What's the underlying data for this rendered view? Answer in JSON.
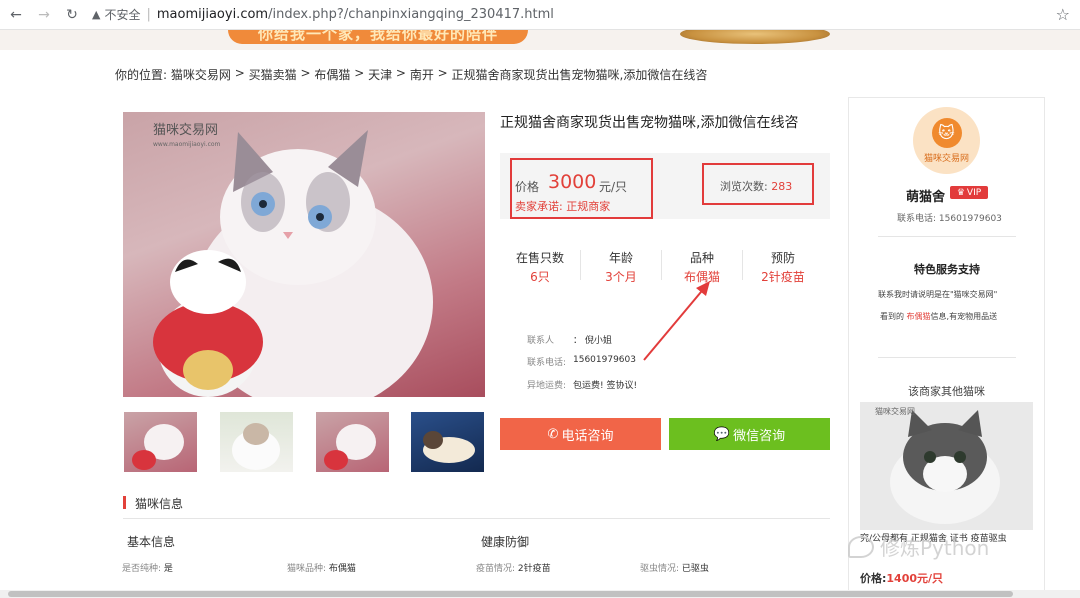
{
  "browser": {
    "back_icon": "arrow-left-icon",
    "forward_icon": "arrow-right-icon",
    "reload_icon": "reload-icon",
    "security_label": "不安全",
    "url_domain": "maomijiaoyi.com",
    "url_path": "/index.php?/chanpinxiangqing_230417.html",
    "bookmark_icon": "star-icon"
  },
  "banner": {
    "slogan": "你给我一个家，我给你最好的陪伴"
  },
  "breadcrumb": {
    "prefix": "你的位置:",
    "items": [
      "猫咪交易网",
      "买猫卖猫",
      "布偶猫",
      "天津",
      "南开",
      "正规猫舍商家现货出售宠物猫咪,添加微信在线咨"
    ],
    "separator": ">"
  },
  "product": {
    "title": "正规猫舍商家现货出售宠物猫咪,添加微信在线咨",
    "photo_watermark_cn": "猫咪交易网",
    "photo_watermark_url": "www.maomijiaoyi.com",
    "price_label": "价格",
    "price_value": "3000",
    "price_unit": "元/只",
    "promise": "卖家承诺: 正规商家",
    "views_label": "浏览次数:",
    "views_value": "283",
    "stats": [
      {
        "label": "在售只数",
        "value": "6只"
      },
      {
        "label": "年龄",
        "value": "3个月"
      },
      {
        "label": "品种",
        "value": "布偶猫"
      },
      {
        "label": "预防",
        "value": "2针疫苗"
      }
    ],
    "contact": {
      "person_label": "联系人",
      "person_value": "： 倪小姐",
      "phone_label": "联系电话:",
      "phone_value": "15601979603",
      "shipping_label": "异地运费:",
      "shipping_value": "包运费! 签协议!"
    },
    "phone_button": "电话咨询",
    "wechat_button": "微信咨询",
    "phone_icon": "phone-icon",
    "wechat_icon": "wechat-icon"
  },
  "info": {
    "section_title": "猫咪信息",
    "basic_title": "基本信息",
    "health_title": "健康防御",
    "items": [
      {
        "label": "是否纯种:",
        "value": "是"
      },
      {
        "label": "猫咪品种:",
        "value": "布偶猫"
      },
      {
        "label": "疫苗情况:",
        "value": "2针疫苗"
      },
      {
        "label": "驱虫情况:",
        "value": "已驱虫"
      }
    ]
  },
  "seller": {
    "logo_text": "猫咪交易网",
    "name": "萌猫舍",
    "vip_label": "VIP",
    "phone_label": "联系电话:",
    "phone": "15601979603",
    "service_title": "特色服务支持",
    "service_note": "联系我时请说明是在\"猫咪交易网\"",
    "service_note2_prefix": "看到的",
    "service_note2_highlight": "布偶猫",
    "service_note2_suffix": "信息,有宠物用品送",
    "other_title": "该商家其他猫咪",
    "other_desc": "究/公母都有 正规猫舍 证书 疫苗驱虫",
    "other_price_label": "价格:",
    "other_price": "1400元/只"
  },
  "watermark_text": "修炼Python",
  "colors": {
    "accent_red": "#e2413a",
    "phone_button": "#f16548",
    "wechat_button": "#6cbf1f",
    "annotation_red": "#e23b3b"
  }
}
